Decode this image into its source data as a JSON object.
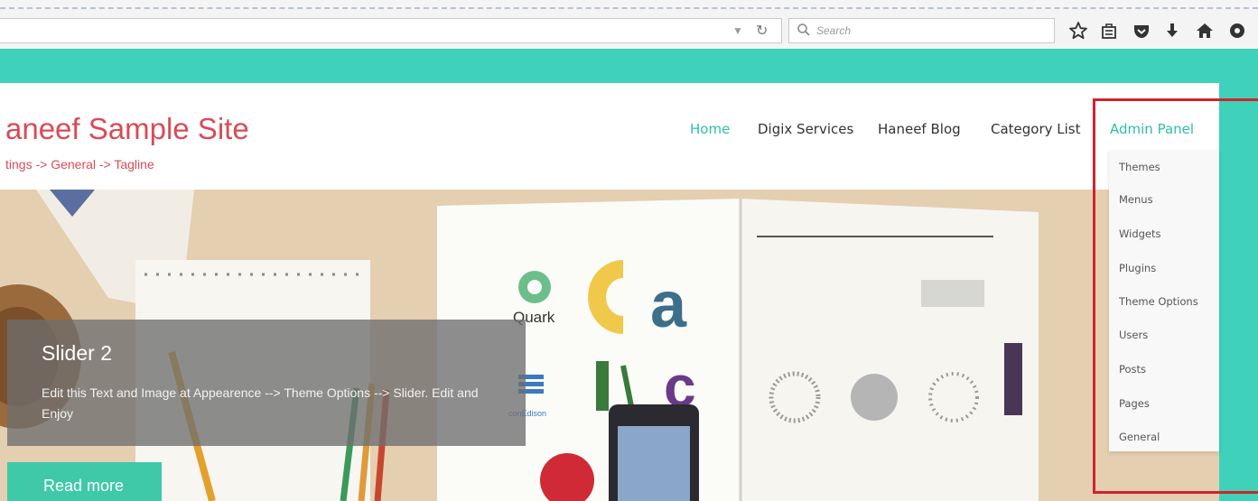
{
  "browser": {
    "search_placeholder": "Search",
    "toolbar_icons": [
      "bookmark-star-icon",
      "reading-list-icon",
      "pocket-icon",
      "download-icon",
      "home-icon",
      "extension-icon"
    ]
  },
  "site": {
    "title": "aneef Sample Site",
    "tagline": "tings -> General -> Tagline"
  },
  "nav": {
    "items": [
      "Home",
      "Digix Services",
      "Haneef Blog",
      "Category List",
      "Admin Panel"
    ],
    "active": "Home"
  },
  "admin_menu": {
    "items": [
      "Themes",
      "Menus",
      "Widgets",
      "Plugins",
      "Theme Options",
      "Users",
      "Posts",
      "Pages",
      "General"
    ]
  },
  "slider": {
    "title": "Slider 2",
    "text": "Edit this Text and Image at Appearence --> Theme Options --> Slider. Edit and Enjoy",
    "button": "Read more"
  },
  "hero_logos": {
    "quark": "Quark",
    "conedison": "conEdison"
  },
  "colors": {
    "teal": "#3fd1ba",
    "title_red": "#d94b56",
    "nav_active": "#2fbfa6",
    "highlight_frame": "#d1232a",
    "button": "#3fc9a9"
  }
}
